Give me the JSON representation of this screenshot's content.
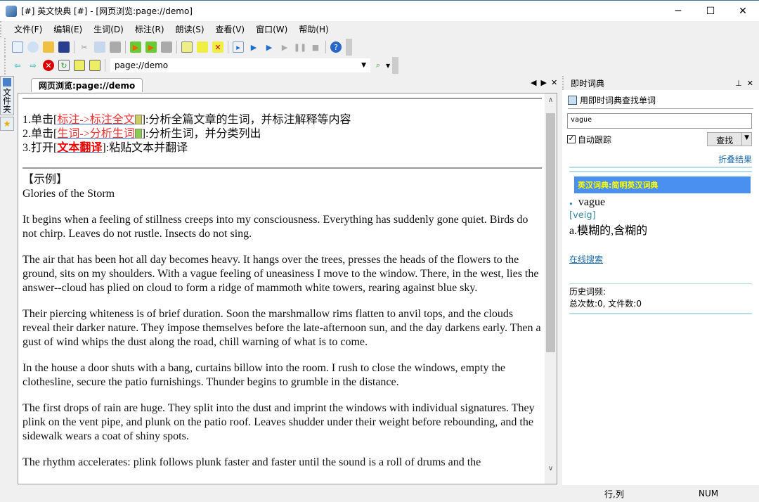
{
  "window": {
    "title": "[#] 英文快典 [#] - [网页浏览:page://demo]",
    "minimize": "─",
    "maximize": "☐",
    "close": "✕"
  },
  "menu": [
    "文件(F)",
    "编辑(E)",
    "生词(D)",
    "标注(R)",
    "朗读(S)",
    "查看(V)",
    "窗口(W)",
    "帮助(H)"
  ],
  "address": {
    "value": "page://demo"
  },
  "left_tabs": [
    "文件夹"
  ],
  "doc_tab": {
    "label": "网页浏览:page://demo"
  },
  "doc": {
    "steps": [
      {
        "prefix": "1.单击[",
        "link": "标注->标注全文",
        "suffix": "]:分析全篇文章的生词，并标注解释等内容"
      },
      {
        "prefix": "2.单击[",
        "link": "生词->分析生词",
        "suffix": "]:分析生词，并分类列出"
      },
      {
        "prefix": "3.打开[",
        "link": "文本翻译",
        "suffix": "]:粘贴文本并翻译"
      }
    ],
    "example_label": "【示例】",
    "article_title": "Glories of the Storm",
    "paragraphs": [
      "It begins when a feeling of stillness creeps into my consciousness. Everything has suddenly gone quiet. Birds do not chirp. Leaves do not rustle. Insects do not sing.",
      "The air that has been hot all day becomes heavy. It hangs over the trees, presses the heads of the flowers to the ground, sits on my shoulders. With a vague feeling of uneasiness I move to the window. There, in the west, lies the answer--cloud has plied on cloud to form a ridge of mammoth white towers, rearing against blue sky.",
      "Their piercing whiteness is of brief duration. Soon the marshmallow rims flatten to anvil tops, and the clouds reveal their darker nature. They impose themselves before the late-afternoon sun, and the day darkens early. Then a gust of wind whips the dust along the road, chill warning of what is to come.",
      "In the house a door shuts with a bang, curtains billow into the room. I rush to close the windows, empty the clothesline, secure the patio furnishings. Thunder begins to grumble in the distance.",
      "The first drops of rain are huge. They split into the dust and imprint the windows with individual signatures. They plink on the vent pipe, and plunk on the patio roof. Leaves shudder under their weight before rebounding, and the sidewalk wears a coat of shiny spots.",
      "The rhythm accelerates: plink follows plunk faster and faster until the sound is a roll of drums and the"
    ]
  },
  "dict_panel": {
    "title": "即时词典",
    "subtitle": "用即时词典查找单词",
    "search_value": "vague",
    "auto_track_label": "自动跟踪",
    "auto_track_checked": true,
    "search_button": "查找",
    "collapse_link": "折叠结果",
    "dict_name": "英汉词典:简明英汉词典",
    "word": "vague",
    "phonetic": "[veig]",
    "definition": "a.模糊的,含糊的",
    "online_link": "在线搜索",
    "history_label": "历史词频:",
    "history_counts": "总次数:0, 文件数:0"
  },
  "status": {
    "position": "行,列",
    "num": "NUM"
  }
}
